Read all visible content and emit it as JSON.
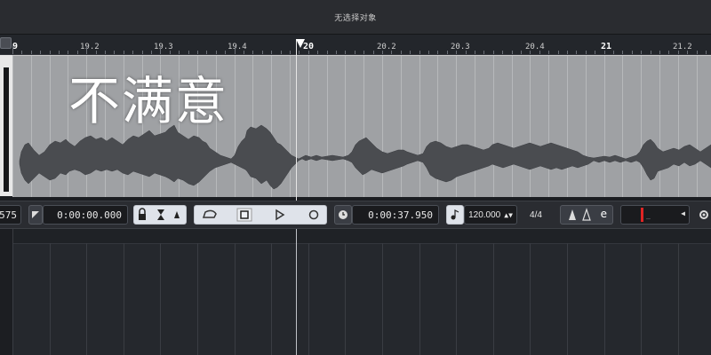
{
  "window": {
    "title": "无选择对象"
  },
  "ruler": {
    "labels": [
      "9",
      "19.2",
      "19.3",
      "19.4",
      "20",
      "20.2",
      "20.3",
      "20.4",
      "21",
      "21.2"
    ],
    "major_labels": [
      "9",
      "20",
      "21"
    ]
  },
  "overlay": {
    "text": "不满意"
  },
  "transport": {
    "left_value": "575",
    "position_time": "0:00:00.000",
    "cycle_time": "0:00:37.950",
    "tempo": "120.000",
    "signature": "4/4",
    "metronome_letter": "e"
  },
  "icons": {
    "settings": "gear-icon",
    "lock": "lock-icon",
    "clock": "clock-icon",
    "tempo": "tempo-note-icon",
    "play": "play-icon",
    "stop": "stop-icon",
    "record": "record-icon",
    "cycle": "cycle-icon"
  },
  "colors": {
    "track_bg": "#9fa1a4",
    "waveform": "#4a4c50",
    "accent_red": "#e02424"
  }
}
